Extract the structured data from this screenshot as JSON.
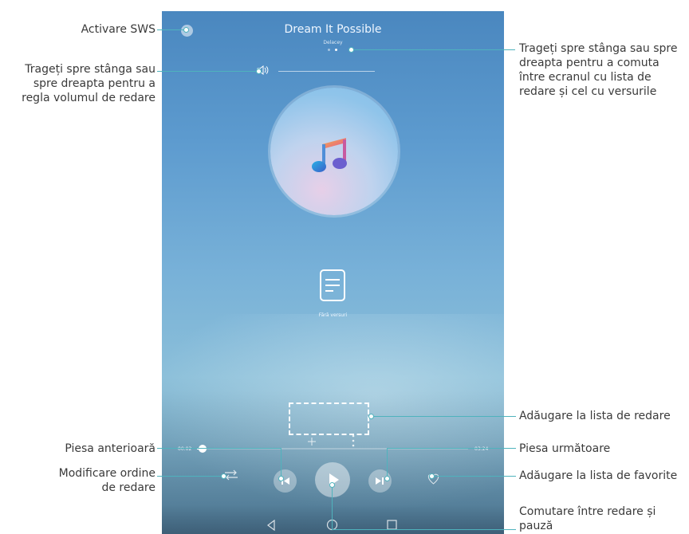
{
  "player": {
    "song_title": "Dream It Possible",
    "artist": "Delacey",
    "lyrics_status": "Fără versuri",
    "time_elapsed": "00:02",
    "time_total": "03:24",
    "progress": 0.02,
    "page_indicator": {
      "count": 2,
      "active": 2
    }
  },
  "icons": {
    "sws": "sws-toggle-icon",
    "volume": "speaker-icon",
    "album": "music-note-icon",
    "lyrics": "document-icon",
    "add": "plus-icon",
    "more": "more-vertical-icon",
    "order": "shuffle-icon",
    "previous": "skip-previous-icon",
    "play": "play-icon",
    "next": "skip-next-icon",
    "favorite": "heart-icon",
    "nav_back": "triangle-back-icon",
    "nav_home": "circle-home-icon",
    "nav_recent": "square-recent-icon"
  },
  "annotations": {
    "sws": "Activare SWS",
    "volume": [
      "Trageți spre stânga sau",
      "spre dreapta pentru a",
      "regla volumul de redare"
    ],
    "swipe": [
      "Trageți spre stânga sau spre",
      "dreapta pentru a comuta",
      "între ecranul cu lista de",
      "redare și cel cu versurile"
    ],
    "add_playlist": "Adăugare la lista de redare",
    "previous": "Piesa anterioară",
    "next": "Piesa următoare",
    "order": [
      "Modificare ordine",
      "de redare"
    ],
    "favorite": "Adăugare la lista de favorite",
    "play_pause": [
      "Comutare între redare și",
      "pauză"
    ]
  },
  "colors": {
    "callout_line": "#4fb3bd",
    "callout_text": "#3a3a3a",
    "screen_top": "#4a87bf",
    "screen_mid": "#8bbfd9"
  }
}
